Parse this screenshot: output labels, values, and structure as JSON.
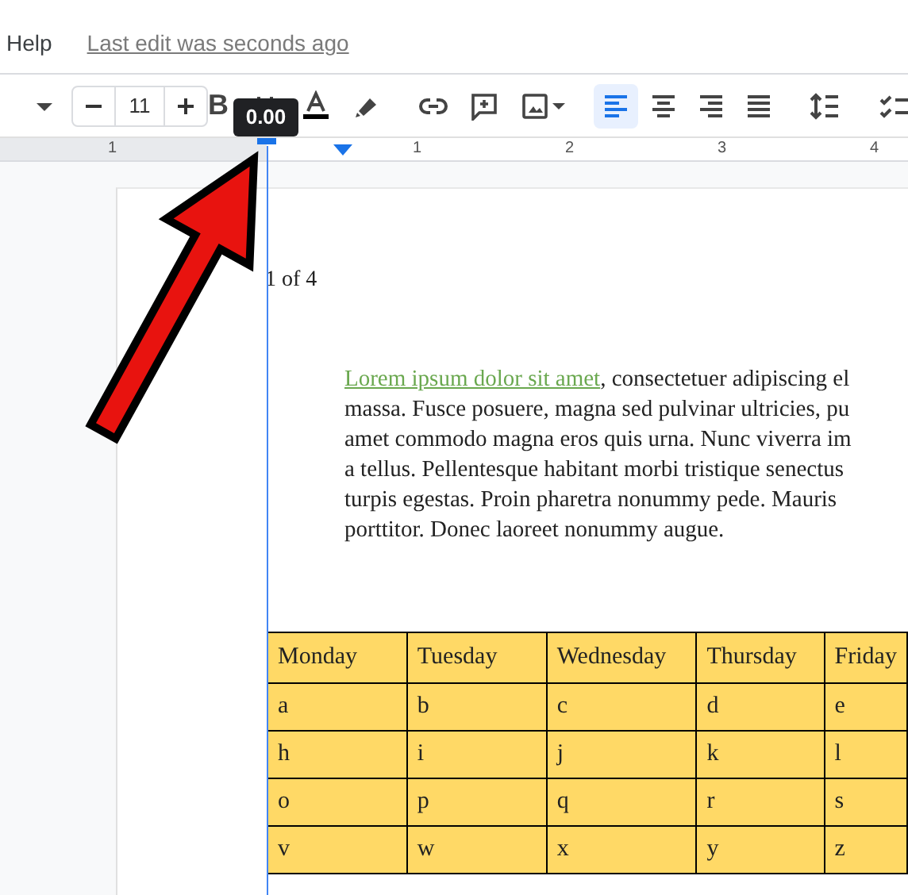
{
  "menu": {
    "items": [
      "Help"
    ],
    "last_edit": "Last edit was seconds ago"
  },
  "toolbar": {
    "font_size": "11",
    "bold": "B",
    "alignment": [
      {
        "kind": "left",
        "selected": true
      },
      {
        "kind": "center",
        "selected": false
      },
      {
        "kind": "right",
        "selected": false
      },
      {
        "kind": "justify",
        "selected": false
      }
    ]
  },
  "ruler": {
    "labels": [
      "1",
      "1",
      "2",
      "3",
      "4"
    ],
    "tooltip": "0.00"
  },
  "document": {
    "page_number": "1 of 4",
    "paragraph": {
      "link": "Lorem ipsum dolor sit amet",
      "lines": [
        ", consectetuer adipiscing el",
        "massa. Fusce posuere, magna sed pulvinar ultricies, pu",
        "amet commodo magna eros quis urna. Nunc viverra im",
        "a tellus. Pellentesque habitant morbi tristique senectus",
        "turpis egestas. Proin pharetra nonummy pede. Mauris",
        "porttitor. Donec laoreet nonummy augue."
      ]
    },
    "table": {
      "columns": [
        "Monday",
        "Tuesday",
        "Wednesday",
        "Thursday",
        "Friday"
      ],
      "rows": [
        [
          "a",
          "b",
          "c",
          "d",
          "e"
        ],
        [
          "h",
          "i",
          "j",
          "k",
          "l"
        ],
        [
          "o",
          "p",
          "q",
          "r",
          "s"
        ],
        [
          "v",
          "w",
          "x",
          "y",
          "z"
        ]
      ]
    }
  }
}
